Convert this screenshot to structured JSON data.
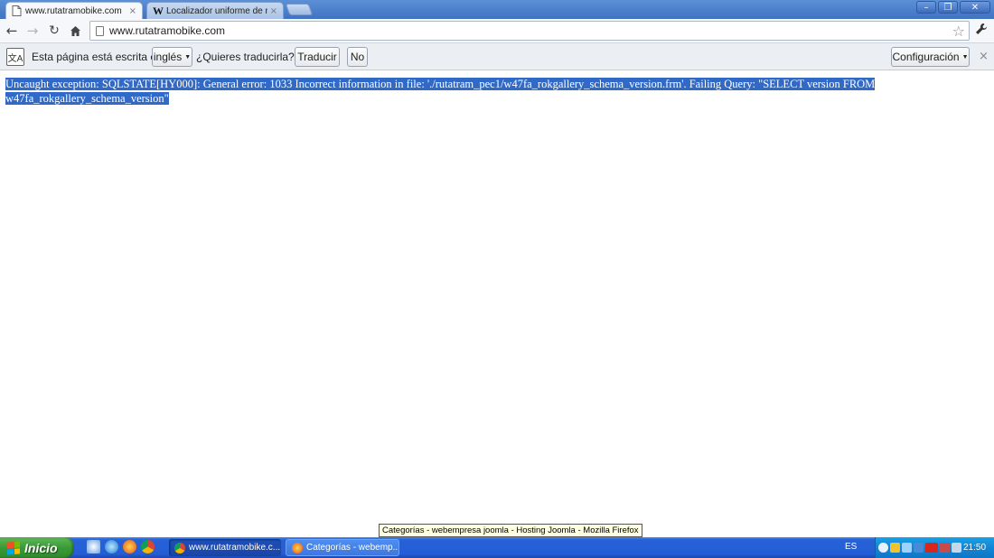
{
  "browser": {
    "tabs": [
      {
        "title": "www.rutatramobike.com",
        "active": true
      },
      {
        "title": "Localizador uniforme de recur",
        "favicon": "W",
        "active": false
      }
    ],
    "tab_close_glyph": "×",
    "window_buttons": {
      "minimize": "–",
      "restore": "❐",
      "close": "✕"
    },
    "url": "www.rutatramobike.com"
  },
  "translate_bar": {
    "icon_text": "文A",
    "text_before": "Esta página está escrita en",
    "language": "inglés",
    "question": "¿Quieres traducirla?",
    "translate_label": "Traducir",
    "no_label": "No",
    "config_label": "Configuración",
    "close_glyph": "×"
  },
  "page": {
    "error_line_1": "Uncaught exception: SQLSTATE[HY000]: General error: 1033 Incorrect information in file: './rutatram_pec1/w47fa_rokgallery_schema_version.frm'. Failing Query: \"SELECT version FROM",
    "error_line_2": "w47fa_rokgallery_schema_version\""
  },
  "tooltip": "Categorías - webempresa joomla - Hosting Joomla - Mozilla Firefox",
  "taskbar": {
    "start_label": "Inicio",
    "quicklaunch": [
      "desktop-icon",
      "ie-icon",
      "firefox-icon",
      "chrome-icon"
    ],
    "tasks": [
      {
        "label": "www.rutatramobike.c...",
        "icon": "chrome-icon",
        "active": true
      },
      {
        "label": "Categorías - webemp...",
        "icon": "firefox-icon",
        "active": false
      }
    ],
    "language_indicator": "ES",
    "clock": "21:50"
  },
  "colors": {
    "selection_highlight": "#3169c6",
    "taskbar_blue": "#245ed6",
    "start_green": "#3a9a36",
    "tray_blue": "#1286d6"
  }
}
